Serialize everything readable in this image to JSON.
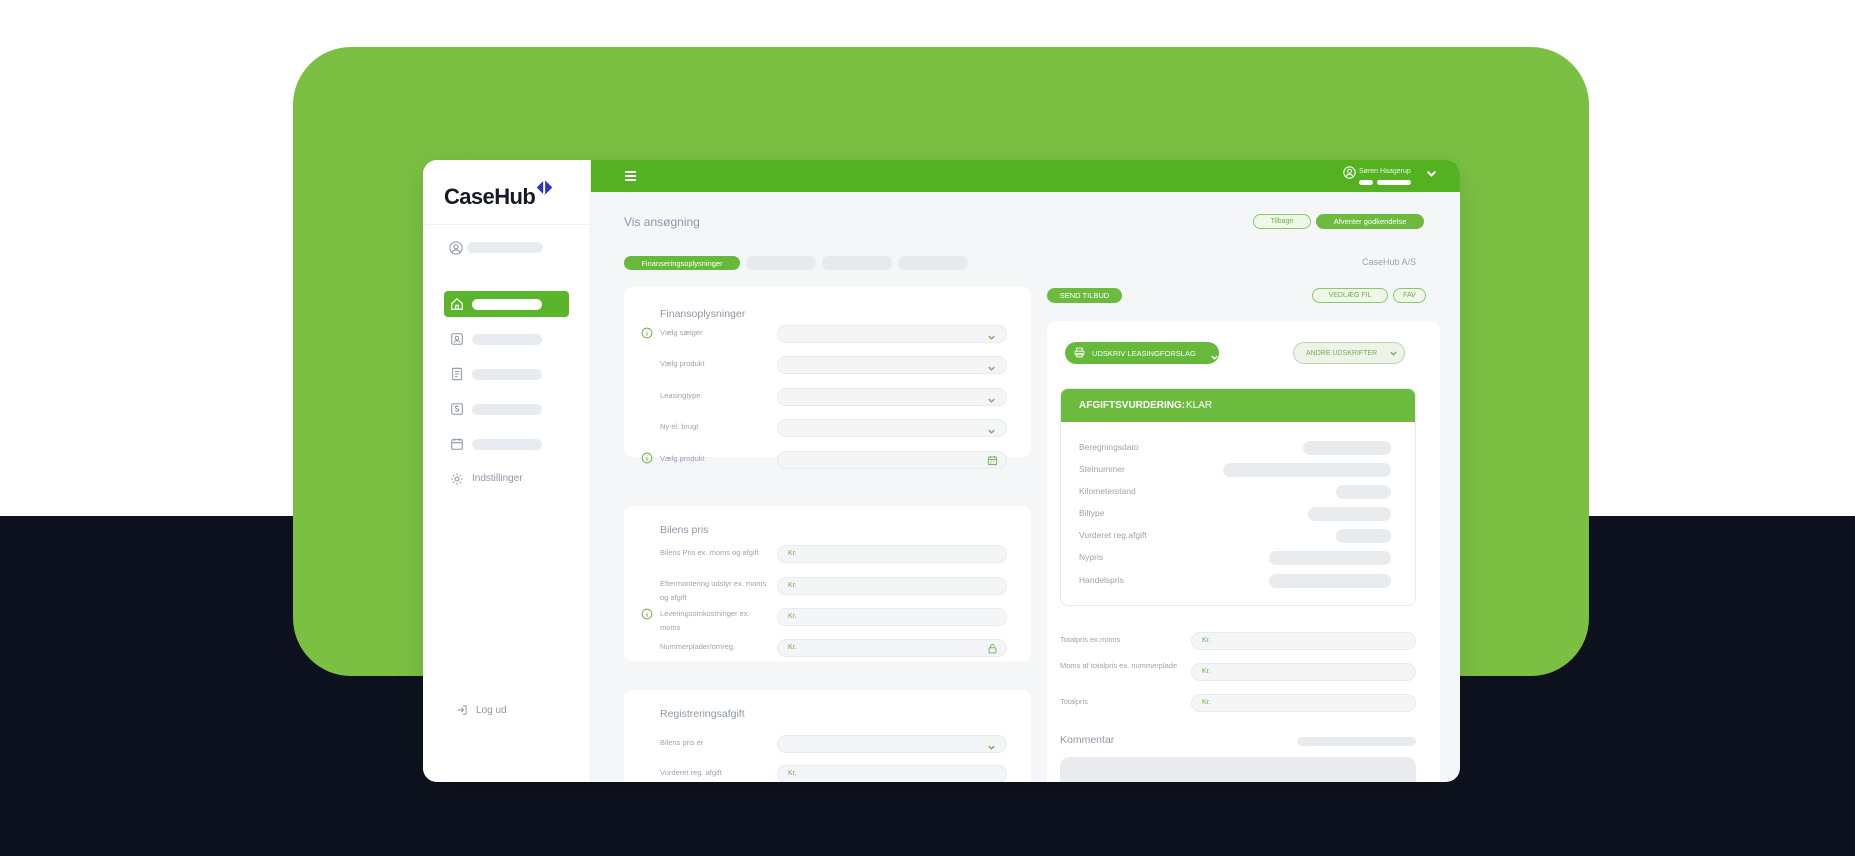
{
  "app": {
    "logo_text": "CaseHub",
    "user_name": "Søren Haagerup",
    "company": "CaseHub A/S"
  },
  "sidebar": {
    "settings_label": "Indstillinger",
    "logout_label": "Log ud"
  },
  "header": {
    "title": "Vis ansøgning",
    "back_label": "Tilbage",
    "status_label": "Afventer godkendelse"
  },
  "tabs": {
    "active_label": "Finanseringsoplysninger"
  },
  "finans": {
    "title": "Finansoplysninger",
    "fields": [
      "Vælg sælger",
      "Vælg produkt",
      "Leasingtype",
      "Ny el. brugt",
      "Vælg produkt"
    ]
  },
  "bilens_pris": {
    "title": "Bilens pris",
    "fields": [
      "Bilens Pris ex. moms og afgift",
      "Eftermontering udstyr ex. moms og afgift",
      "Leveringsomkostninger ex. moms",
      "Nummerplader/omreg."
    ],
    "currency": "Kr."
  },
  "registrering": {
    "title": "Registreringsafgift",
    "fields": [
      "Bilens pris er",
      "Vurderet reg. afgift"
    ]
  },
  "actions": {
    "send_offer": "SEND TILBUD",
    "attach_file": "VEDLÆG FIL",
    "fav": "FAV",
    "print_label": "UDSKRIV LEASINGFORSLAG",
    "other_prints": "ANDRE UDSKRIFTER"
  },
  "tax": {
    "title": "AFGIFTSVURDERING:",
    "status": "KLAR",
    "rows": [
      "Beregningsdato",
      "Stelnummer",
      "Kilometerstand",
      "Biltype",
      "Vurderet reg.afgift",
      "Nypris",
      "Handelspris"
    ]
  },
  "totals": {
    "rows": [
      "Totalpris ex.moms",
      "Moms af totalpris ex. nummerplade",
      "Totalpris"
    ],
    "currency": "Kr."
  },
  "comment": {
    "title": "Kommentar"
  },
  "colors": {
    "brand_green": "#54b121",
    "accent_green": "#6dbb3e",
    "background_green": "#7bc043",
    "dark_navy": "#0e121e",
    "logo_mark": "#2b34c9"
  }
}
